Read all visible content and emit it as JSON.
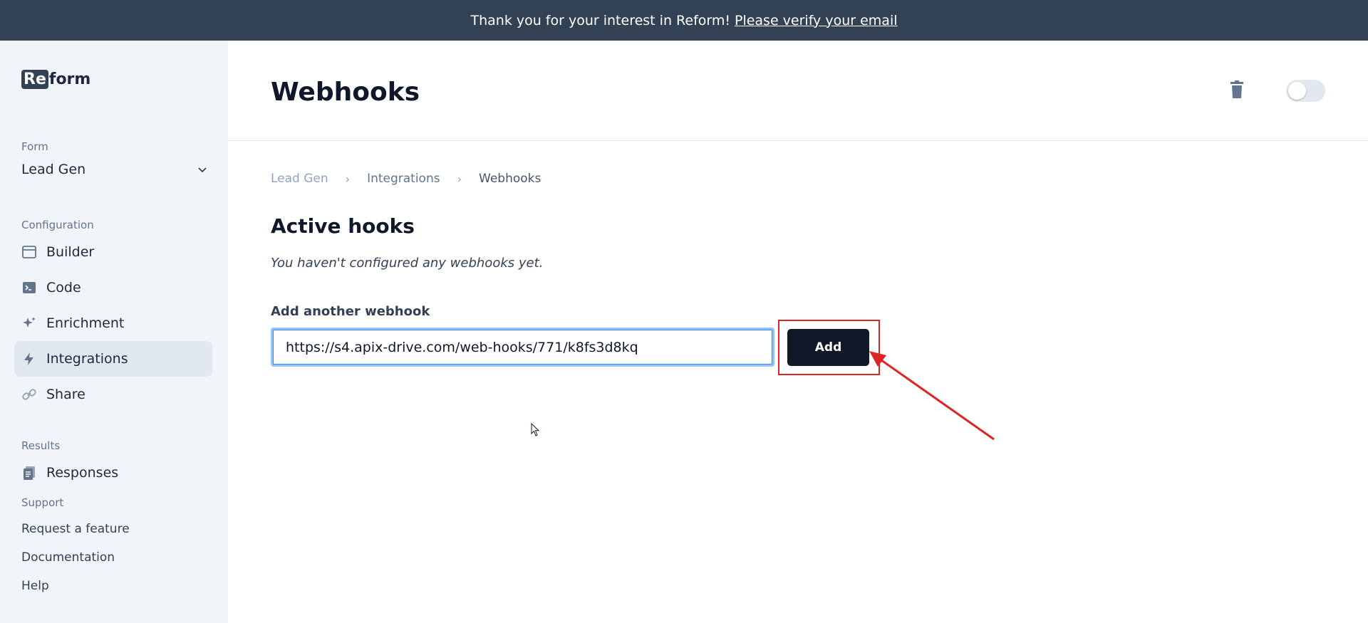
{
  "banner": {
    "text": "Thank you for your interest in Reform!",
    "link": "Please verify your email"
  },
  "sidebar": {
    "logo_mark": "Re",
    "logo_rest": "form",
    "form_label": "Form",
    "form_value": "Lead Gen",
    "config_label": "Configuration",
    "items": [
      {
        "label": "Builder",
        "icon": "browser-window-icon"
      },
      {
        "label": "Code",
        "icon": "terminal-icon"
      },
      {
        "label": "Enrichment",
        "icon": "sparkles-icon"
      },
      {
        "label": "Integrations",
        "icon": "lightning-bolt-icon"
      },
      {
        "label": "Share",
        "icon": "link-icon"
      }
    ],
    "results_label": "Results",
    "responses_label": "Responses",
    "support_label": "Support",
    "support_links": [
      "Request a feature",
      "Documentation",
      "Help"
    ]
  },
  "main": {
    "title": "Webhooks",
    "breadcrumb": [
      "Lead Gen",
      "Integrations",
      "Webhooks"
    ],
    "section_title": "Active hooks",
    "empty_message": "You haven't configured any webhooks yet.",
    "field_label": "Add another webhook",
    "input_value": "https://s4.apix-drive.com/web-hooks/771/k8fs3d8kq",
    "add_button": "Add"
  },
  "colors": {
    "banner_bg": "#334155",
    "sidebar_bg": "#f1f5f9",
    "button_bg": "#111827",
    "annotation": "#dc2626",
    "input_focus": "#93c5fd"
  }
}
